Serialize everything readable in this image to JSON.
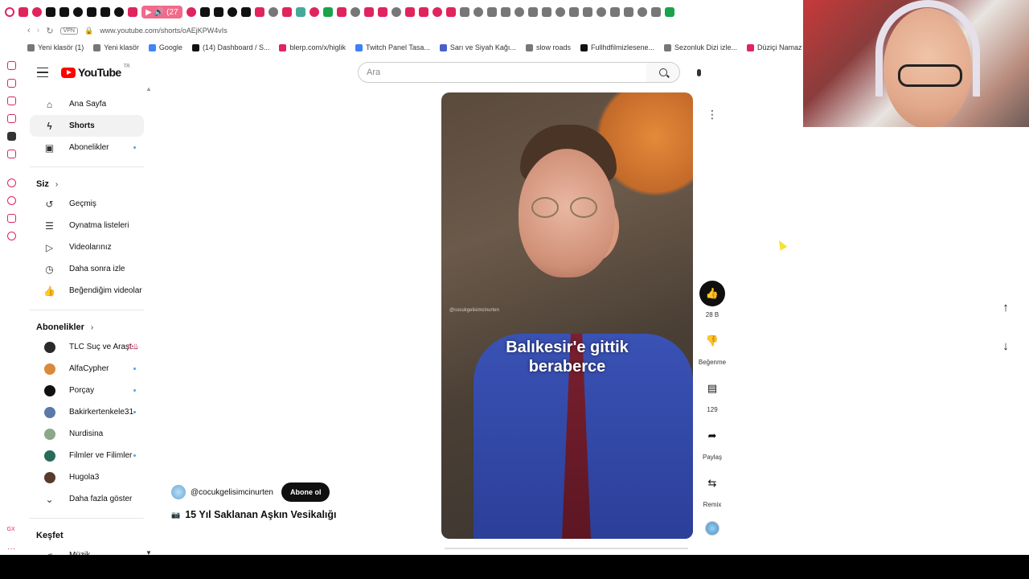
{
  "browser": {
    "active_tab_label": "(27",
    "url": "www.youtube.com/shorts/oAEjKPW4vIs",
    "vpn_label": "VPN",
    "tab_icon_colors": [
      "#e0245e",
      "#e0245e",
      "#111",
      "#111",
      "#111",
      "#111",
      "#111",
      "#111",
      "#e0245e",
      "#e0245e",
      "#e0245e",
      "#111",
      "#111",
      "#111",
      "#111",
      "#e0245e",
      "#777",
      "#e0245e",
      "#4a9",
      "#e0245e",
      "#1aa34a",
      "#e0245e",
      "#777",
      "#e0245e",
      "#e0245e",
      "#777",
      "#e0245e",
      "#e0245e",
      "#e0245e",
      "#e0245e",
      "#777",
      "#777",
      "#777",
      "#777",
      "#777",
      "#777",
      "#777",
      "#777",
      "#777",
      "#777",
      "#777",
      "#777",
      "#777",
      "#777",
      "#777",
      "#1aa34a"
    ],
    "bookmarks": [
      {
        "label": "Yeni klasör (1)",
        "color": "#777"
      },
      {
        "label": "Yeni klasör",
        "color": "#777"
      },
      {
        "label": "Google",
        "color": "#4285f4"
      },
      {
        "label": "(14) Dashboard / S...",
        "color": "#111"
      },
      {
        "label": "blerp.com/x/higlik",
        "color": "#e0245e"
      },
      {
        "label": "Twitch Panel Tasa...",
        "color": "#3b82f6"
      },
      {
        "label": "Sarı ve Siyah Kağı...",
        "color": "#4a60c9"
      },
      {
        "label": "slow roads",
        "color": "#777"
      },
      {
        "label": "Fullhdfilmizlesene...",
        "color": "#111"
      },
      {
        "label": "Sezonluk Dizi izle...",
        "color": "#777"
      },
      {
        "label": "Düziçi Namaz Vak",
        "color": "#e0245e"
      }
    ]
  },
  "youtube": {
    "logo_text": "YouTube",
    "logo_region": "TR",
    "search_placeholder": "Ara",
    "sidebar": {
      "main": [
        {
          "label": "Ana Sayfa",
          "icon": "home-icon"
        },
        {
          "label": "Shorts",
          "icon": "shorts-icon"
        },
        {
          "label": "Abonelikler",
          "icon": "subscriptions-icon"
        }
      ],
      "you_title": "Siz",
      "you_items": [
        {
          "label": "Geçmiş",
          "icon": "history-icon"
        },
        {
          "label": "Oynatma listeleri",
          "icon": "playlist-icon"
        },
        {
          "label": "Videolarınız",
          "icon": "your-videos-icon"
        },
        {
          "label": "Daha sonra izle",
          "icon": "watch-later-icon"
        },
        {
          "label": "Beğendiğim videolar",
          "icon": "liked-icon"
        }
      ],
      "subs_title": "Abonelikler",
      "subscriptions": [
        {
          "label": "TLC Suç ve Araşt...",
          "color": "#2a2a2a",
          "status": "live"
        },
        {
          "label": "AlfaCypher",
          "color": "#d98a3a",
          "status": "dot"
        },
        {
          "label": "Porçay",
          "color": "#111111",
          "status": "dot"
        },
        {
          "label": "Bakirkertenkele31",
          "color": "#5a7aa8",
          "status": "dot"
        },
        {
          "label": "Nurdisina",
          "color": "#8aa88a",
          "status": ""
        },
        {
          "label": "Filmler ve Filimler",
          "color": "#2a6a5a",
          "status": "dot"
        },
        {
          "label": "Hugola3",
          "color": "#5a3a2a",
          "status": ""
        }
      ],
      "show_more": "Daha fazla göster",
      "explore_title": "Keşfet",
      "explore_items": [
        {
          "label": "Müzik",
          "icon": "music-icon"
        }
      ]
    },
    "short": {
      "caption_line1": "Balıkesir'e gittik",
      "caption_line2": "beraberce",
      "watermark": "@cocukgelisimcinurten",
      "channel_handle": "@cocukgelisimcinurten",
      "subscribe_label": "Abone ol",
      "title_emoji": "📷",
      "title": "15 Yıl Saklanan Aşkın Vesikalığı",
      "actions": {
        "like_count": "28 B",
        "dislike_label": "Beğenme",
        "comment_count": "129",
        "share_label": "Paylaş",
        "remix_label": "Remix"
      }
    }
  }
}
